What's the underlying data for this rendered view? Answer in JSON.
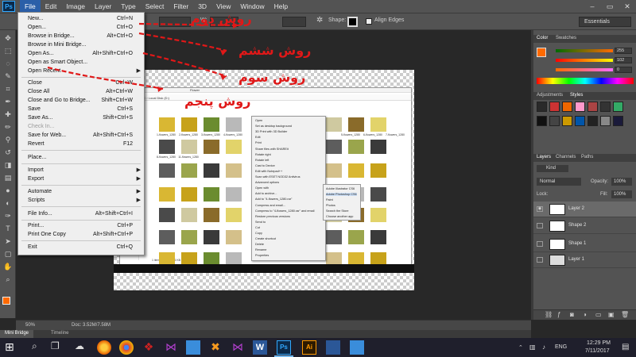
{
  "app": {
    "logo_text": "Ps",
    "menus": [
      "File",
      "Edit",
      "Image",
      "Layer",
      "Type",
      "Select",
      "Filter",
      "3D",
      "View",
      "Window",
      "Help"
    ],
    "window_controls": [
      "–",
      "▭",
      "✕"
    ]
  },
  "options_bar": {
    "weight_label": "W:",
    "shape_label": "Shape:",
    "align_edges_label": "Align Edges",
    "workspace": "Essentials"
  },
  "file_menu": {
    "items": [
      {
        "label": "New...",
        "shortcut": "Ctrl+N"
      },
      {
        "label": "Open...",
        "shortcut": "Ctrl+O"
      },
      {
        "label": "Browse in Bridge...",
        "shortcut": "Alt+Ctrl+O"
      },
      {
        "label": "Browse in Mini Bridge...",
        "shortcut": ""
      },
      {
        "label": "Open As...",
        "shortcut": "Alt+Shift+Ctrl+O"
      },
      {
        "label": "Open as Smart Object...",
        "shortcut": ""
      },
      {
        "label": "Open Recent",
        "shortcut": "",
        "submenu": true
      },
      {
        "label": "Close",
        "shortcut": "Ctrl+W"
      },
      {
        "label": "Close All",
        "shortcut": "Alt+Ctrl+W"
      },
      {
        "label": "Close and Go to Bridge...",
        "shortcut": "Shift+Ctrl+W"
      },
      {
        "label": "Save",
        "shortcut": "Ctrl+S"
      },
      {
        "label": "Save As...",
        "shortcut": "Shift+Ctrl+S"
      },
      {
        "label": "Check In...",
        "shortcut": "",
        "disabled": true
      },
      {
        "label": "Save for Web...",
        "shortcut": "Alt+Shift+Ctrl+S"
      },
      {
        "label": "Revert",
        "shortcut": "F12"
      },
      {
        "label": "Place...",
        "shortcut": ""
      },
      {
        "label": "Import",
        "shortcut": "",
        "submenu": true
      },
      {
        "label": "Export",
        "shortcut": "",
        "submenu": true
      },
      {
        "label": "Automate",
        "shortcut": "",
        "submenu": true
      },
      {
        "label": "Scripts",
        "shortcut": "",
        "submenu": true
      },
      {
        "label": "File Info...",
        "shortcut": "Alt+Shift+Ctrl+I"
      },
      {
        "label": "Print...",
        "shortcut": "Ctrl+P"
      },
      {
        "label": "Print One Copy",
        "shortcut": "Alt+Shift+Ctrl+P"
      },
      {
        "label": "Exit",
        "shortcut": "Ctrl+Q"
      }
    ]
  },
  "annotations": [
    "روش دوم",
    "روش ششم",
    "روش سوم",
    "روش پنجم"
  ],
  "inner_screenshot": {
    "context_menu": [
      "Open",
      "Set as desktop background",
      "3D Print with 3D Builder",
      "Edit",
      "Print",
      "Share files with SHAREit",
      "Rotate right",
      "Rotate left",
      "Cast to Device",
      "Edit with Notepad++",
      "Scan with ESET NOD32 Antivirus",
      "Advanced options",
      "Open with",
      "Add to archive...",
      "Add to \"4-flowers_1280.rar\"",
      "Compress and email...",
      "Compress to \"4-flowers_1280.rar\" and email",
      "Restore previous versions",
      "Send to",
      "Cut",
      "Copy",
      "Create shortcut",
      "Delete",
      "Rename",
      "Properties"
    ],
    "open_with_submenu": [
      "Adobe Illustrator CS6",
      "Adobe Photoshop CS6",
      "Paint",
      "Photos",
      "Search the Store",
      "Choose another app"
    ],
    "thumb_labels": [
      "1-flowers_1280",
      "2-flowers_1280",
      "3-flowers_1280",
      "4-flowers_1280",
      "5-flowers_1280",
      "6-flowers_1280",
      "7-flowers_1280",
      "8-flowers_1280",
      "11-flowers_1280"
    ],
    "breadcrumb": "This PC › Local Disk (D:)",
    "folder_title": "Flower",
    "status": "1 item selected 106 KB"
  },
  "color_panel": {
    "tabs": [
      "Color",
      "Swatches"
    ],
    "values": [
      "255",
      "102",
      "0"
    ],
    "foreground_color": "#ff6a00"
  },
  "adjustments_panel": {
    "tabs": [
      "Adjustments",
      "Styles"
    ]
  },
  "layers_panel": {
    "tabs": [
      "Layers",
      "Channels",
      "Paths"
    ],
    "filter_kind": "Kind",
    "blend_mode": "Normal",
    "opacity_label": "Opacity:",
    "opacity_value": "100%",
    "lock_label": "Lock:",
    "fill_label": "Fill:",
    "fill_value": "100%",
    "layers": [
      "Layer 2",
      "Shape 2",
      "Shape 1",
      "Layer 1"
    ]
  },
  "status_bar": {
    "zoom": "50%",
    "doc_info": "Doc: 3.52M/7.58M"
  },
  "bottom_tabs": [
    "Mini Bridge",
    "Timeline"
  ],
  "taskbar": {
    "language": "ENG",
    "time": "12:29 PM",
    "date": "7/11/2017",
    "ps_label": "Ps",
    "ai_label": "Ai"
  },
  "colors": {
    "accent_red": "#e01818",
    "highlight": "#99c1ef",
    "ps_blue": "#31a8ff"
  }
}
